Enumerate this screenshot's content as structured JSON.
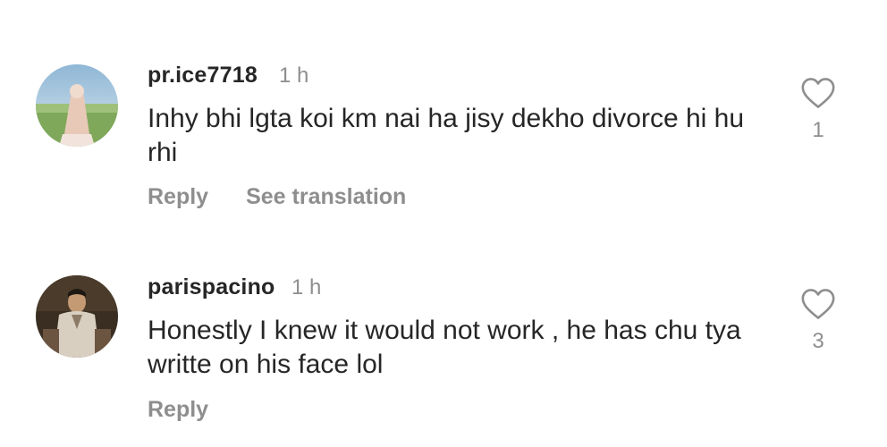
{
  "comments": [
    {
      "username": "pr.ice7718",
      "time": "1 h",
      "text": "Inhy bhi lgta koi km nai ha jisy dekho divorce hi hu rhi",
      "actions": [
        "Reply",
        "See translation"
      ],
      "likes": "1",
      "avatar": "avatar-woman-in-field"
    },
    {
      "username": "parispacino",
      "time": "1 h",
      "text": "Honestly I knew it would not work , he has chu tya writte on his face lol",
      "actions": [
        "Reply"
      ],
      "likes": "3",
      "avatar": "avatar-man-seated-dark"
    }
  ],
  "icons": {
    "like": "heart-outline-icon"
  },
  "colors": {
    "text": "#262626",
    "muted": "#8e8e8e",
    "background": "#ffffff"
  }
}
